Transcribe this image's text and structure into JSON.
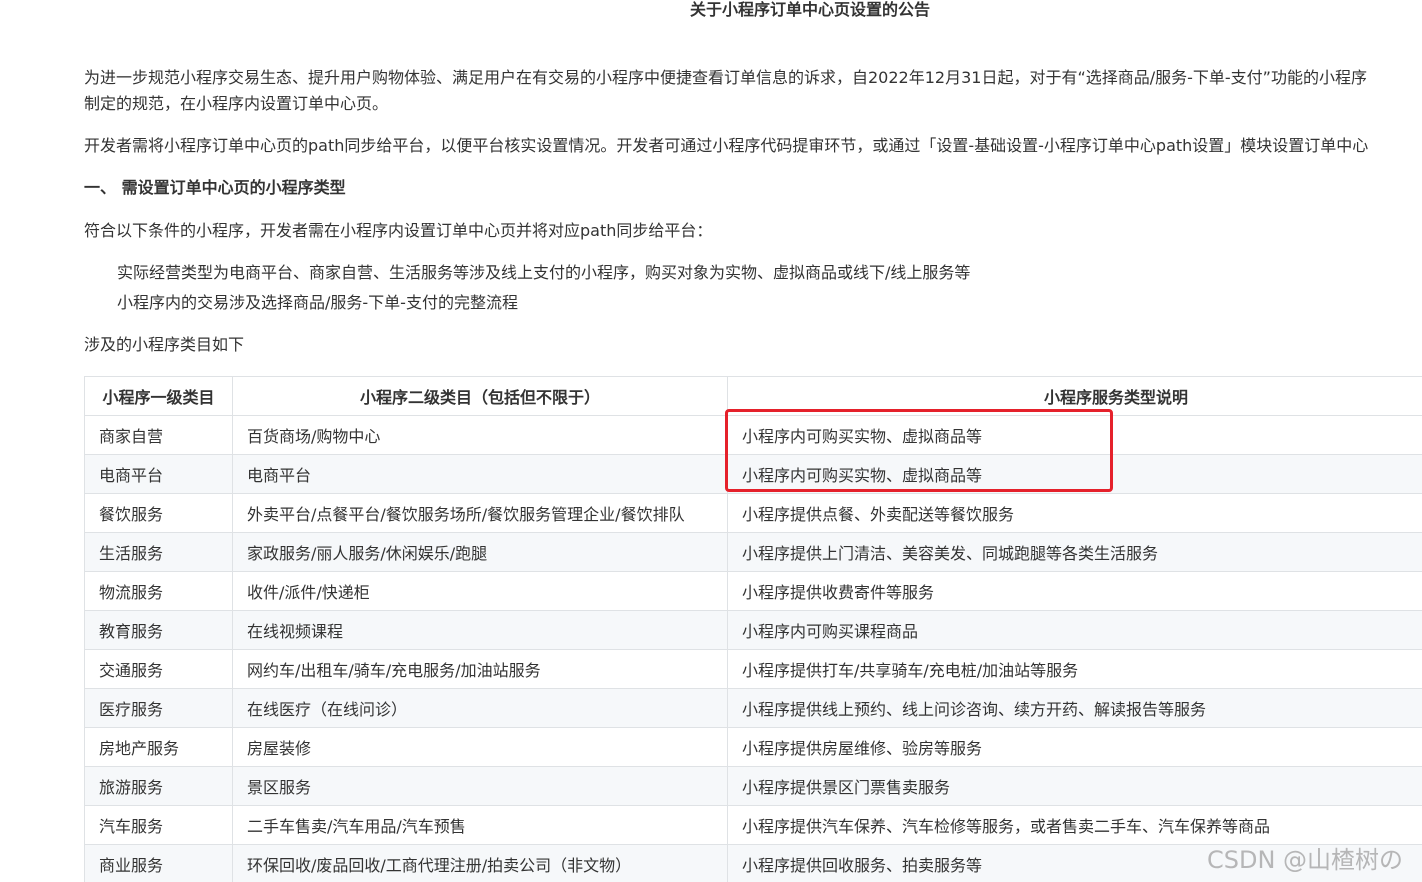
{
  "title": "关于小程序订单中心页设置的公告",
  "paragraphs": {
    "p1_line1": "为进一步规范小程序交易生态、提升用户购物体验、满足用户在有交易的小程序中便捷查看订单信息的诉求，自2022年12月31日起，对于有“选择商品/服务-下单-支付”功能的小程序",
    "p1_line2": "制定的规范，在小程序内设置订单中心页。",
    "p2": "开发者需将小程序订单中心页的path同步给平台，以便平台核实设置情况。开发者可通过小程序代码提审环节，或通过「设置-基础设置-小程序订单中心path设置」模块设置订单中心"
  },
  "section1": {
    "heading": "一、 需设置订单中心页的小程序类型",
    "intro": "符合以下条件的小程序，开发者需在小程序内设置订单中心页并将对应path同步给平台：",
    "conditions": [
      "实际经营类型为电商平台、商家自营、生活服务等涉及线上支付的小程序，购买对象为实物、虚拟商品或线下/线上服务等",
      "小程序内的交易涉及选择商品/服务-下单-支付的完整流程"
    ],
    "table_intro": "涉及的小程序类目如下"
  },
  "table": {
    "headers": [
      "小程序一级类目",
      "小程序二级类目（包括但不限于）",
      "小程序服务类型说明"
    ],
    "rows": [
      [
        "商家自营",
        "百货商场/购物中心",
        "小程序内可购买实物、虚拟商品等"
      ],
      [
        "电商平台",
        "电商平台",
        "小程序内可购买实物、虚拟商品等"
      ],
      [
        "餐饮服务",
        "外卖平台/点餐平台/餐饮服务场所/餐饮服务管理企业/餐饮排队",
        "小程序提供点餐、外卖配送等餐饮服务"
      ],
      [
        "生活服务",
        "家政服务/丽人服务/休闲娱乐/跑腿",
        "小程序提供上门清洁、美容美发、同城跑腿等各类生活服务"
      ],
      [
        "物流服务",
        "收件/派件/快递柜",
        "小程序提供收费寄件等服务"
      ],
      [
        "教育服务",
        "在线视频课程",
        "小程序内可购买课程商品"
      ],
      [
        "交通服务",
        "网约车/出租车/骑车/充电服务/加油站服务",
        "小程序提供打车/共享骑车/充电桩/加油站等服务"
      ],
      [
        "医疗服务",
        "在线医疗（在线问诊）",
        "小程序提供线上预约、线上问诊咨询、续方开药、解读报告等服务"
      ],
      [
        "房地产服务",
        "房屋装修",
        "小程序提供房屋维修、验房等服务"
      ],
      [
        "旅游服务",
        "景区服务",
        "小程序提供景区门票售卖服务"
      ],
      [
        "汽车服务",
        "二手车售卖/汽车用品/汽车预售",
        "小程序提供汽车保养、汽车检修等服务，或者售卖二手车、汽车保养等商品"
      ],
      [
        "商业服务",
        "环保回收/废品回收/工商代理注册/拍卖公司（非文物）",
        "小程序提供回收服务、拍卖服务等"
      ]
    ]
  },
  "annotation": {
    "box_color": "#e5212b"
  },
  "watermark": "CSDN @山楂树の"
}
